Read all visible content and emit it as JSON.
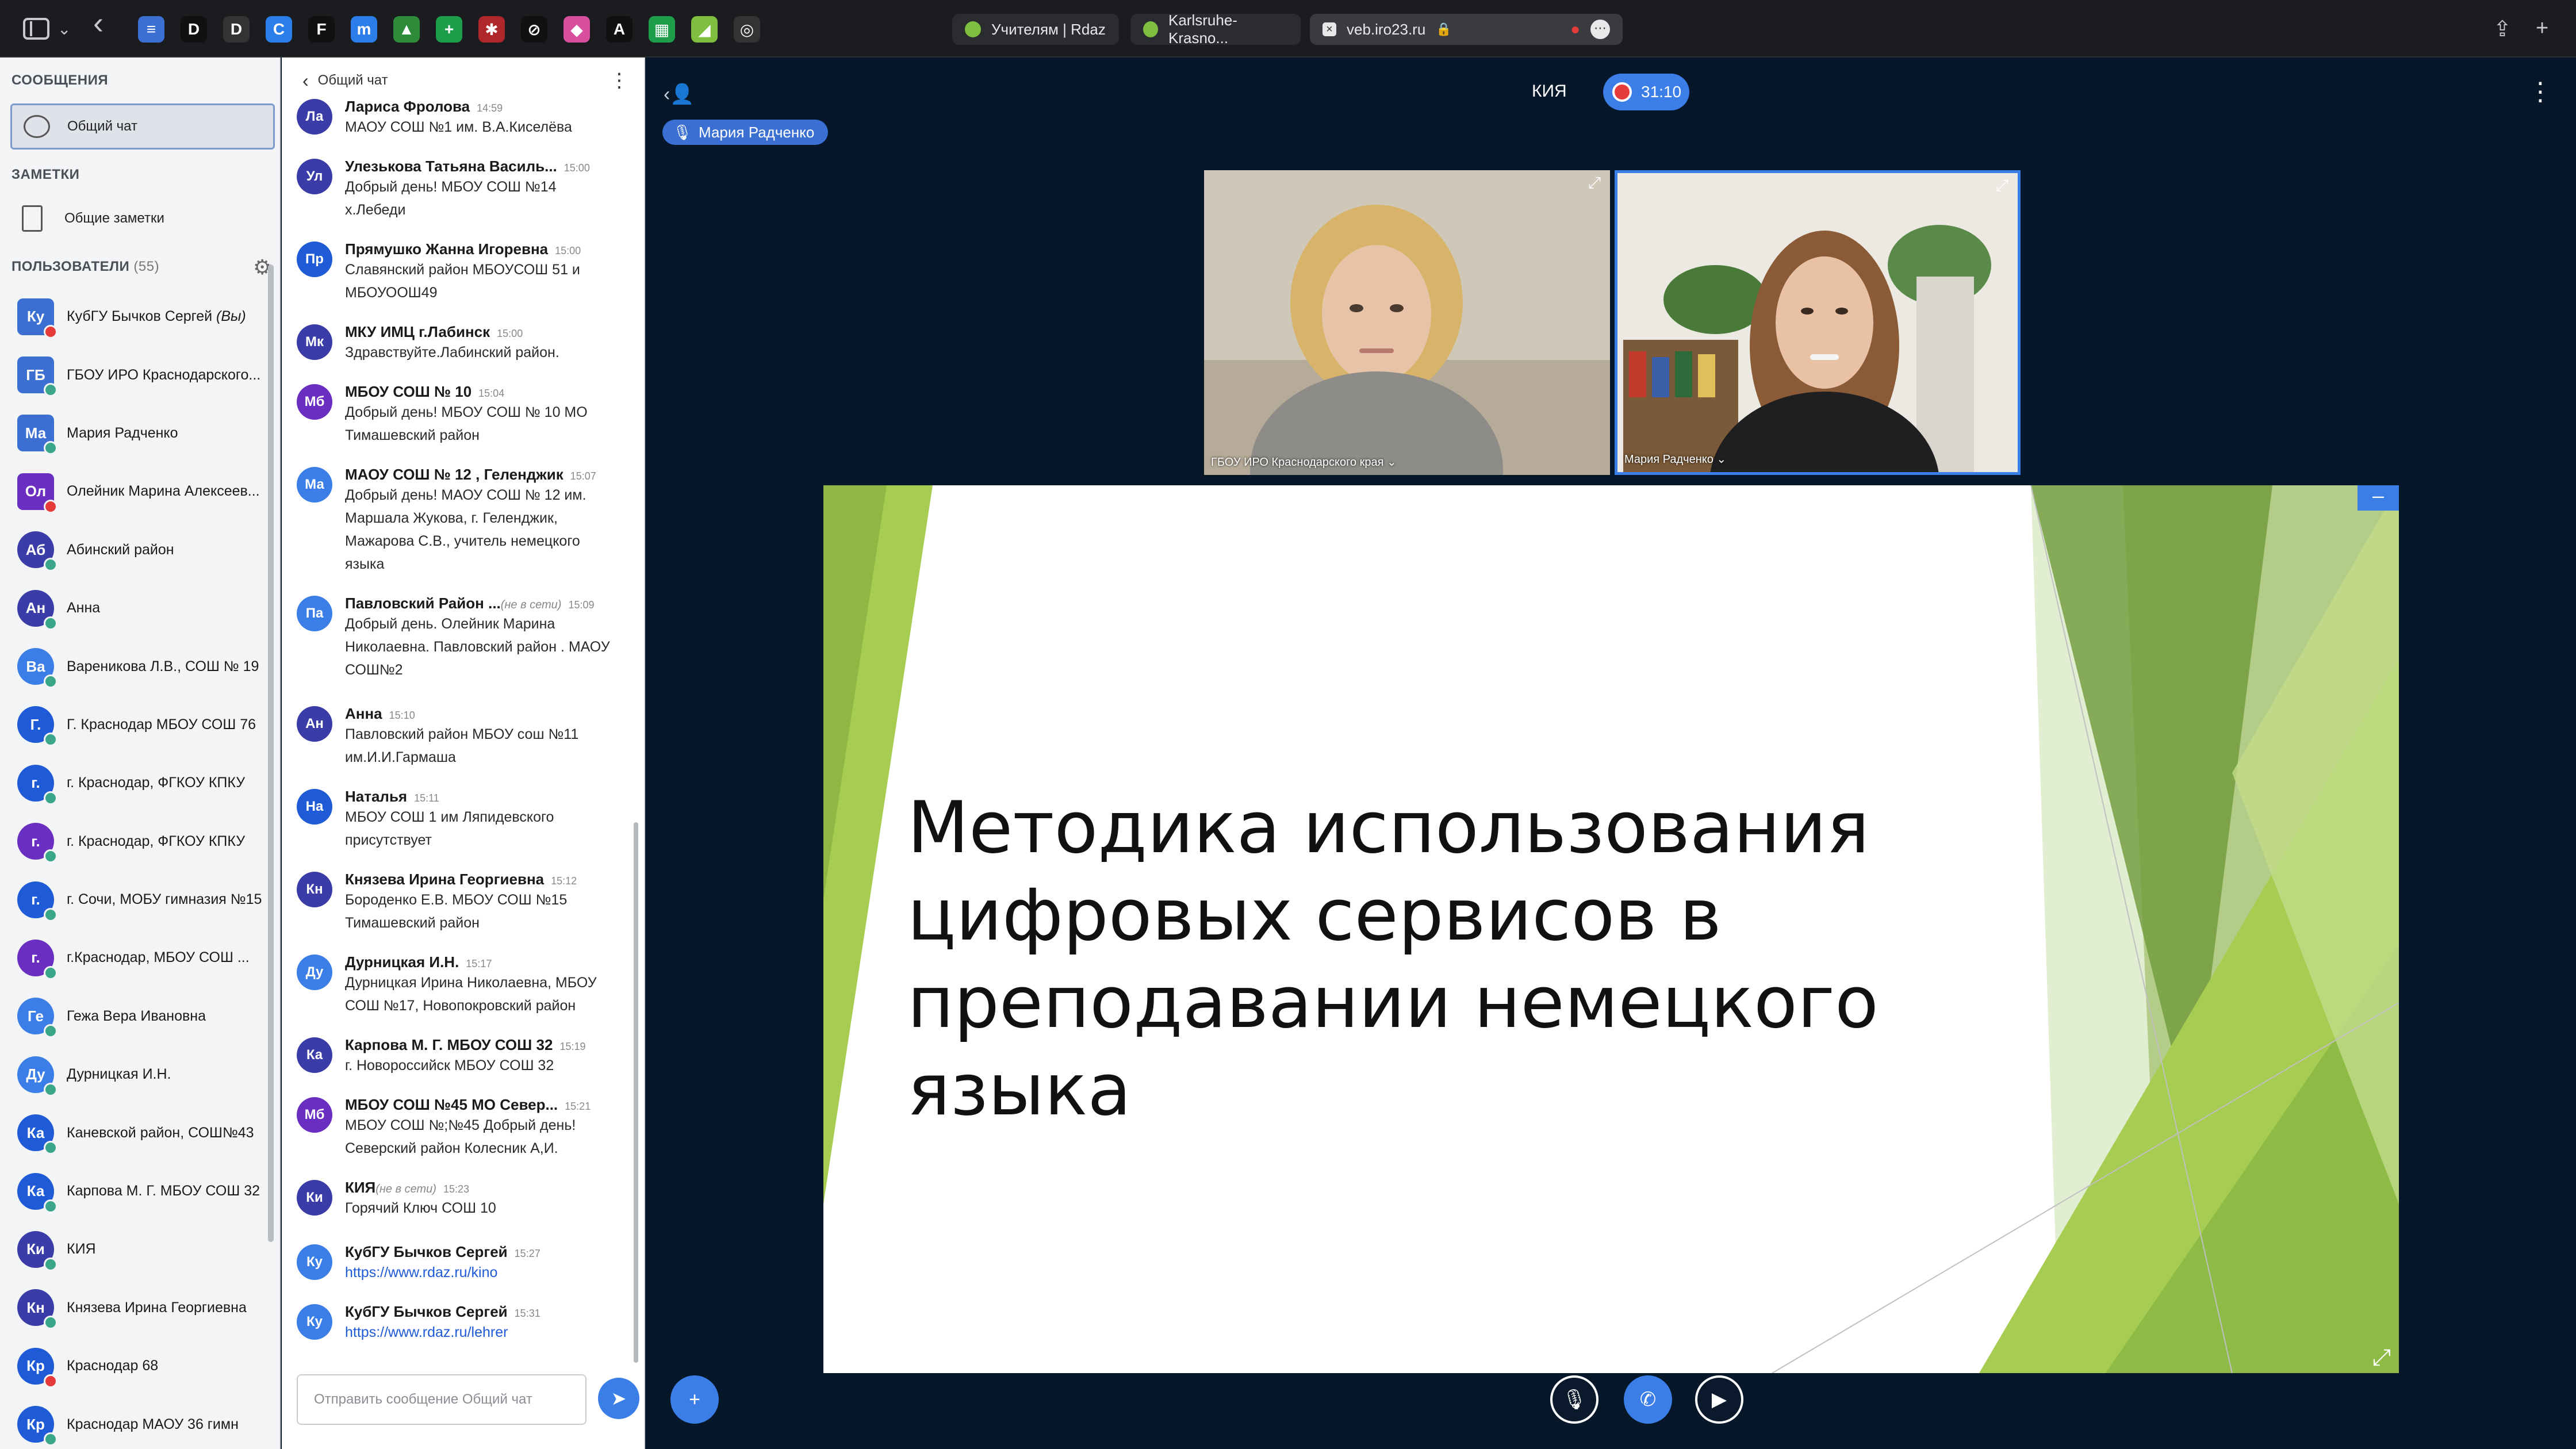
{
  "browser": {
    "favorites": [
      {
        "icon": "docs-icon",
        "letter": "≡",
        "color": "#3b6fd2"
      },
      {
        "icon": "d-icon",
        "letter": "D",
        "color": "#111111"
      },
      {
        "icon": "d-dark-icon",
        "letter": "D",
        "color": "#333333"
      },
      {
        "icon": "c-icon",
        "letter": "C",
        "color": "#2b7de9"
      },
      {
        "icon": "feather-icon",
        "letter": "F",
        "color": "#111111"
      },
      {
        "icon": "m-icon",
        "letter": "m",
        "color": "#2b7de9"
      },
      {
        "icon": "drive-icon",
        "letter": "▲",
        "color": "#2e8b3a"
      },
      {
        "icon": "plus-icon",
        "letter": "+",
        "color": "#1e9e4a"
      },
      {
        "icon": "bug-icon",
        "letter": "✱",
        "color": "#b0272b"
      },
      {
        "icon": "block-icon",
        "letter": "⊘",
        "color": "#111111"
      },
      {
        "icon": "paint-icon",
        "letter": "◆",
        "color": "#d94fa0"
      },
      {
        "icon": "a-icon",
        "letter": "A",
        "color": "#111111"
      },
      {
        "icon": "sheet-icon",
        "letter": "▦",
        "color": "#1e9e4a"
      },
      {
        "icon": "leaf-icon",
        "letter": "◢",
        "color": "#7fbf3f"
      },
      {
        "icon": "box-icon",
        "letter": "◎",
        "color": "#333333"
      }
    ],
    "tabs": [
      {
        "title": "Учителям | Rdaz"
      },
      {
        "title": "Karlsruhe-Krasno..."
      }
    ],
    "address": "veb.iro23.ru"
  },
  "sidebar": {
    "messages_title": "СООБЩЕНИЯ",
    "public_chat_label": "Общий чат",
    "notes_title": "ЗАМЕТКИ",
    "shared_notes_label": "Общие заметки",
    "users_title": "ПОЛЬЗОВАТЕЛИ",
    "users_count": "(55)",
    "users": [
      {
        "initials": "Ку",
        "name": "КубГУ Бычков Сергей",
        "suffix": "(Вы)",
        "color": "#3b6fd2",
        "status": "#e63b3b",
        "round": false
      },
      {
        "initials": "ГБ",
        "name": "ГБОУ ИРО Краснодарского...",
        "suffix": "",
        "color": "#3b6fd2",
        "status": "#3aa68a",
        "round": false
      },
      {
        "initials": "Ма",
        "name": "Мария Радченко",
        "suffix": "",
        "color": "#3b6fd2",
        "status": "#3aa68a",
        "round": false
      },
      {
        "initials": "Ол",
        "name": "Олейник Марина Алексеев...",
        "suffix": "",
        "color": "#6a2fc0",
        "status": "#e63b3b",
        "round": false
      },
      {
        "initials": "Аб",
        "name": "Абинский район",
        "suffix": "",
        "color": "#3a3da8",
        "status": "#3aa68a",
        "round": true
      },
      {
        "initials": "Ан",
        "name": "Анна",
        "suffix": "",
        "color": "#3a3da8",
        "status": "#3aa68a",
        "round": true
      },
      {
        "initials": "Ва",
        "name": "Вареникова Л.В., СОШ № 19",
        "suffix": "",
        "color": "#3b7ee8",
        "status": "#3aa68a",
        "round": true
      },
      {
        "initials": "Г.",
        "name": "Г. Краснодар МБОУ СОШ 76",
        "suffix": "",
        "color": "#1f5bd6",
        "status": "#3aa68a",
        "round": true
      },
      {
        "initials": "г.",
        "name": "г. Краснодар, ФГКОУ КПКУ",
        "suffix": "",
        "color": "#1f5bd6",
        "status": "#3aa68a",
        "round": true
      },
      {
        "initials": "г.",
        "name": "г. Краснодар, ФГКОУ КПКУ",
        "suffix": "",
        "color": "#6a2fc0",
        "status": "#3aa68a",
        "round": true
      },
      {
        "initials": "г.",
        "name": "г. Сочи, МОБУ гимназия №15",
        "suffix": "",
        "color": "#1f5bd6",
        "status": "#3aa68a",
        "round": true
      },
      {
        "initials": "г.",
        "name": "г.Краснодар, МБОУ СОШ ...",
        "suffix": "",
        "color": "#6a2fc0",
        "status": "#3aa68a",
        "round": true
      },
      {
        "initials": "Ге",
        "name": "Гежа Вера Ивановна",
        "suffix": "",
        "color": "#3b7ee8",
        "status": "#3aa68a",
        "round": true
      },
      {
        "initials": "Ду",
        "name": "Дурницкая И.Н.",
        "suffix": "",
        "color": "#3b7ee8",
        "status": "#3aa68a",
        "round": true
      },
      {
        "initials": "Ка",
        "name": "Каневской район, СОШ№43",
        "suffix": "",
        "color": "#1f5bd6",
        "status": "#3aa68a",
        "round": true
      },
      {
        "initials": "Ка",
        "name": "Карпова М. Г. МБОУ СОШ 32",
        "suffix": "",
        "color": "#1f5bd6",
        "status": "#3aa68a",
        "round": true
      },
      {
        "initials": "Ки",
        "name": "КИЯ",
        "suffix": "",
        "color": "#3a3da8",
        "status": "#3aa68a",
        "round": true
      },
      {
        "initials": "Кн",
        "name": "Князева Ирина Георгиевна",
        "suffix": "",
        "color": "#3a3da8",
        "status": "#3aa68a",
        "round": true
      },
      {
        "initials": "Кр",
        "name": "Краснодар 68",
        "suffix": "",
        "color": "#1f5bd6",
        "status": "#e63b3b",
        "round": true
      },
      {
        "initials": "Кр",
        "name": "Краснодар МАОУ 36 гимн",
        "suffix": "",
        "color": "#1f5bd6",
        "status": "#3aa68a",
        "round": true
      }
    ]
  },
  "chat": {
    "header": "Общий чат",
    "messages": [
      {
        "initials": "Ла",
        "color": "#3a3da8",
        "name": "Лариса Фролова",
        "time": "14:59",
        "offline": "",
        "text": [
          "МАОУ СОШ №1 им. В.А.Киселёва"
        ],
        "link": false
      },
      {
        "initials": "Ул",
        "color": "#3a3da8",
        "name": "Улезькова Татьяна Василь...",
        "time": "15:00",
        "offline": "",
        "text": [
          "Добрый день! МБОУ СОШ №14",
          "х.Лебеди"
        ],
        "link": false
      },
      {
        "initials": "Пр",
        "color": "#1f5bd6",
        "name": "Прямушко Жанна Игоревна",
        "time": "15:00",
        "offline": "",
        "text": [
          "Славянский район МБОУСОШ 51 и",
          "МБОУООШ49"
        ],
        "link": false
      },
      {
        "initials": "Мк",
        "color": "#3a3da8",
        "name": "МКУ ИМЦ г.Лабинск",
        "time": "15:00",
        "offline": "",
        "text": [
          "Здравствуйте.Лабинский район."
        ],
        "link": false
      },
      {
        "initials": "Мб",
        "color": "#6a2fc0",
        "name": "МБОУ СОШ № 10",
        "time": "15:04",
        "offline": "",
        "text": [
          "Добрый день! МБОУ СОШ № 10 МО",
          "Тимашевский район"
        ],
        "link": false
      },
      {
        "initials": "Ма",
        "color": "#3b7ee8",
        "name": "МАОУ СОШ № 12 , Геленджик",
        "time": "15:07",
        "offline": "",
        "text": [
          "Добрый день! МАОУ СОШ № 12 им.",
          "Маршала Жукова, г. Геленджик,",
          "Мажарова С.В., учитель немецкого",
          "языка"
        ],
        "link": false
      },
      {
        "initials": "Па",
        "color": "#3b7ee8",
        "name": "Павловский Район ...",
        "time": "15:09",
        "offline": "(не в сети)",
        "text": [
          "Добрый день. Олейник Марина",
          "Николаевна. Павловский район . МАОУ",
          "СОШ№2"
        ],
        "link": false
      },
      {
        "initials": "Ан",
        "color": "#3a3da8",
        "name": "Анна",
        "time": "15:10",
        "offline": "",
        "text": [
          "Павловский район МБОУ сош №11",
          "им.И.И.Гармаша"
        ],
        "link": false
      },
      {
        "initials": "На",
        "color": "#1f5bd6",
        "name": "Наталья",
        "time": "15:11",
        "offline": "",
        "text": [
          "МБОУ СОШ 1 им Ляпидевского",
          "присутствует"
        ],
        "link": false
      },
      {
        "initials": "Кн",
        "color": "#3a3da8",
        "name": "Князева Ирина Георгиевна",
        "time": "15:12",
        "offline": "",
        "text": [
          "Бороденко Е.В. МБОУ СОШ №15",
          "Тимашевский район"
        ],
        "link": false
      },
      {
        "initials": "Ду",
        "color": "#3b7ee8",
        "name": "Дурницкая И.Н.",
        "time": "15:17",
        "offline": "",
        "text": [
          "Дурницкая Ирина Николаевна, МБОУ",
          "СОШ №17, Новопокровский район"
        ],
        "link": false
      },
      {
        "initials": "Ка",
        "color": "#3a3da8",
        "name": "Карпова М. Г. МБОУ СОШ 32",
        "time": "15:19",
        "offline": "",
        "text": [
          "г. Новороссийск МБОУ СОШ 32"
        ],
        "link": false
      },
      {
        "initials": "Мб",
        "color": "#6a2fc0",
        "name": "МБОУ СОШ №45 МО Север...",
        "time": "15:21",
        "offline": "",
        "text": [
          "МБОУ СОШ №;№45 Добрый день!",
          "Северский район Колесник А,И."
        ],
        "link": false
      },
      {
        "initials": "Ки",
        "color": "#3a3da8",
        "name": "КИЯ",
        "time": "15:23",
        "offline": "(не в сети)",
        "text": [
          "Горячий Ключ СОШ 10"
        ],
        "link": false
      },
      {
        "initials": "Ку",
        "color": "#3b7ee8",
        "name": "КубГУ Бычков Сергей",
        "time": "15:27",
        "offline": "",
        "text": [
          "https://www.rdaz.ru/kino"
        ],
        "link": true
      },
      {
        "initials": "Ку",
        "color": "#3b7ee8",
        "name": "КубГУ Бычков Сергей",
        "time": "15:31",
        "offline": "",
        "text": [
          "https://www.rdaz.ru/lehrer"
        ],
        "link": true
      }
    ],
    "input_placeholder": "Отправить сообщение Общий чат"
  },
  "conference": {
    "room_title": "КИЯ",
    "recording_time": "31:10",
    "talking_user": "Мария Радченко",
    "videos": [
      {
        "name": "ГБОУ ИРО Краснодарского края"
      },
      {
        "name": "Мария Радченко"
      }
    ],
    "slide_title_lines": [
      "Методика использования",
      "цифровых сервисов в",
      "преподавании немецкого языка"
    ]
  }
}
